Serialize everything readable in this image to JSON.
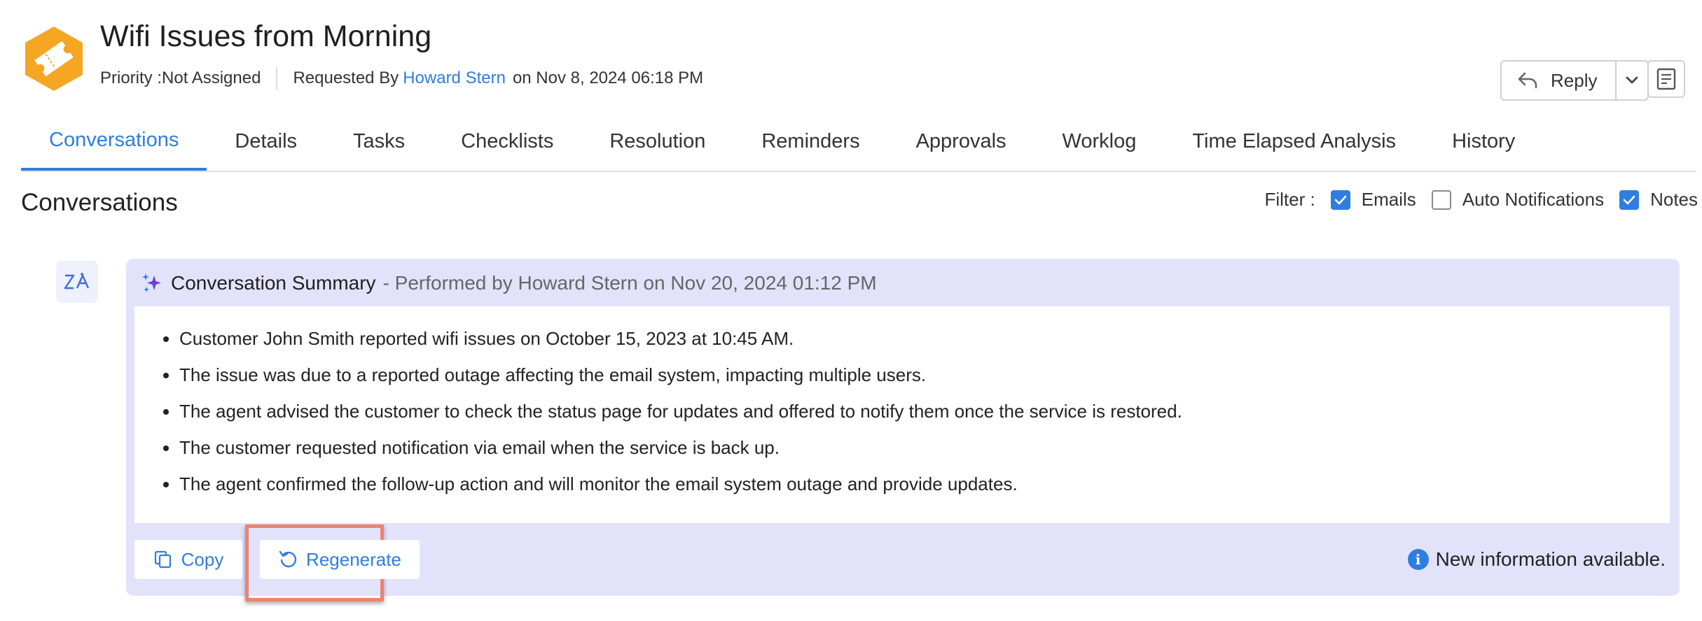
{
  "header": {
    "title": "Wifi Issues from Morning",
    "priority": "Priority :Not Assigned",
    "requested_by_label": "Requested By",
    "requester": "Howard Stern",
    "requested_on": "on Nov 8, 2024 06:18 PM",
    "reply_label": "Reply",
    "brand_color": "#f5a623",
    "icons": [
      "ticket-icon",
      "reply-arrow-icon",
      "chevron-down-icon",
      "notes-icon"
    ]
  },
  "tabs": [
    {
      "label": "Conversations",
      "active": true
    },
    {
      "label": "Details"
    },
    {
      "label": "Tasks"
    },
    {
      "label": "Checklists"
    },
    {
      "label": "Resolution"
    },
    {
      "label": "Reminders"
    },
    {
      "label": "Approvals"
    },
    {
      "label": "Worklog"
    },
    {
      "label": "Time Elapsed Analysis"
    },
    {
      "label": "History"
    }
  ],
  "section": {
    "title": "Conversations",
    "filter_label": "Filter :",
    "filters": [
      {
        "label": "Emails",
        "checked": true
      },
      {
        "label": "Auto Notifications",
        "checked": false
      },
      {
        "label": "Notes",
        "checked": true
      }
    ]
  },
  "summary": {
    "title": "Conversation Summary",
    "performed_by": "- Performed by Howard Stern on Nov 20, 2024 01:12 PM",
    "bullets": [
      "Customer John Smith reported wifi issues on October 15, 2023 at 10:45 AM.",
      "The issue was due to a reported outage affecting the email system, impacting multiple users.",
      "The agent advised the customer to check the status page for updates and offered to notify them once the service is restored.",
      "The customer requested notification via email when the service is back up.",
      "The agent confirmed the follow-up action and will monitor the email system outage and provide updates."
    ],
    "copy_label": "Copy",
    "regenerate_label": "Regenerate",
    "new_info": "New information available.",
    "accent_color": "#2f7de1",
    "highlight_color": "#ee8270"
  }
}
